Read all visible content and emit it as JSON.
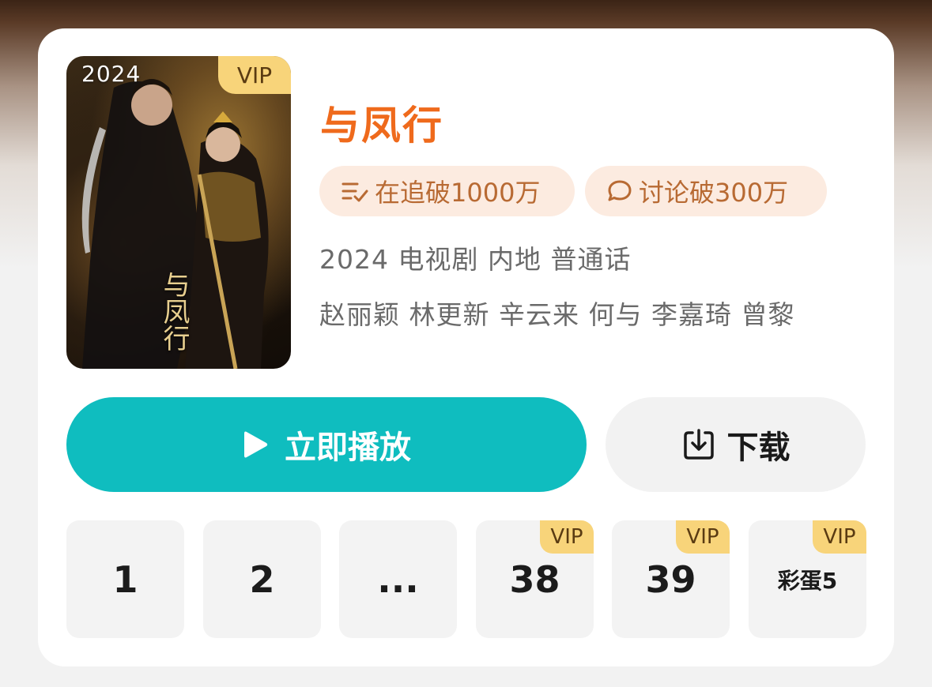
{
  "poster": {
    "year": "2024",
    "vip_badge": "VIP",
    "caption": "与凤行"
  },
  "show": {
    "title": "与凤行",
    "follow_chip": "在追破1000万",
    "discuss_chip": "讨论破300万",
    "info_line": "2024 电视剧 内地 普通话",
    "cast_line": "赵丽颖 林更新 辛云来 何与 李嘉琦 曾黎"
  },
  "actions": {
    "play_label": "立即播放",
    "download_label": "下载"
  },
  "episodes": [
    {
      "label": "1",
      "vip": ""
    },
    {
      "label": "2",
      "vip": ""
    },
    {
      "label": "...",
      "vip": ""
    },
    {
      "label": "38",
      "vip": "VIP"
    },
    {
      "label": "39",
      "vip": "VIP"
    },
    {
      "label": "彩蛋5",
      "vip": "VIP"
    }
  ],
  "icons": {
    "follow": "list-check-icon",
    "discuss": "chat-bubble-icon",
    "play": "play-icon",
    "download": "download-icon"
  },
  "colors": {
    "title": "#ef6a1c",
    "chip_bg": "#fcebe0",
    "chip_text": "#b86a33",
    "play_button": "#0fbdbf",
    "vip_badge": "#f8d47a"
  }
}
